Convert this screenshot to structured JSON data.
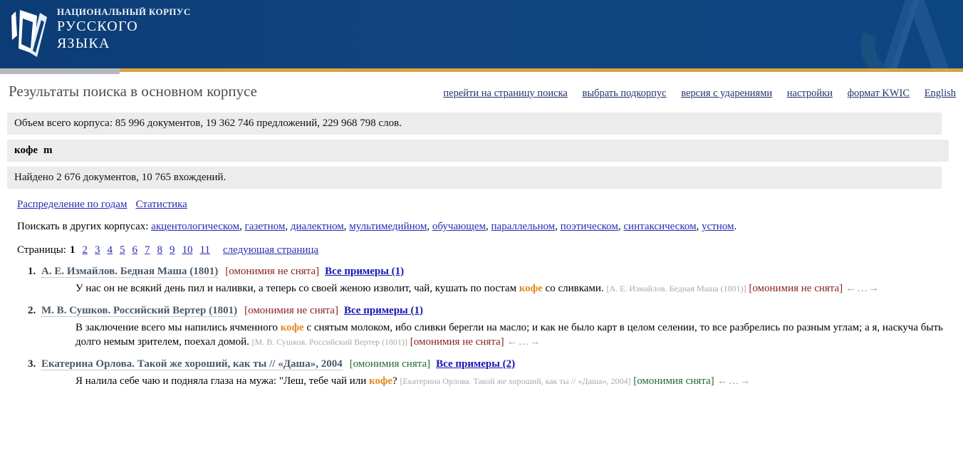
{
  "header": {
    "logo_line1": "Национальный корпус",
    "logo_line2": "Русского",
    "logo_line3": "языка",
    "logo_icon": "open-book-logo",
    "watermark_icon": "letter-a-watermark",
    "brand_blue": "#0c3f7a",
    "accent_gold": "#d9a441"
  },
  "page": {
    "title": "Результаты поиска в основном корпусе"
  },
  "toplinks": [
    {
      "label": "перейти на страницу поиска",
      "name": "link-go-to-search-page"
    },
    {
      "label": "выбрать подкорпус",
      "name": "link-choose-subcorpus"
    },
    {
      "label": "версия с ударениями",
      "name": "link-accented-version"
    },
    {
      "label": "настройки",
      "name": "link-settings"
    },
    {
      "label": "формат KWIC",
      "name": "link-kwic-format"
    },
    {
      "label": "English",
      "name": "link-english"
    }
  ],
  "corpus_info": "Объем всего корпуса: 85 996 документов, 19 362 746 предложений, 229 968 798 слов.",
  "query": {
    "word": "кофе",
    "gram": "m"
  },
  "found_info": "Найдено 2 676 документов, 10 765 вхождений.",
  "stat_links": [
    {
      "label": "Распределение по годам",
      "name": "link-distribution-by-years"
    },
    {
      "label": "Статистика",
      "name": "link-statistics"
    }
  ],
  "other_corpora": {
    "prefix": "Поискать в других корпусах:",
    "items": [
      "акцентологическом",
      "газетном",
      "диалектном",
      "мультимедийном",
      "обучающем",
      "параллельном",
      "поэтическом",
      "синтаксическом",
      "устном"
    ]
  },
  "pagination": {
    "label": "Страницы:",
    "current": "1",
    "pages": [
      "2",
      "3",
      "4",
      "5",
      "6",
      "7",
      "8",
      "9",
      "10",
      "11"
    ],
    "next_label": "следующая страница"
  },
  "results": [
    {
      "title": "А. Е. Измайлов. Бедная Маша (1801)",
      "tag": "[омонимия не снята]",
      "tag_type": "ambiguous",
      "examples_label": "Все примеры (1)",
      "snippet_before": "У нас он не всякий день пил и наливки, а теперь со своей женою изволит, чай, кушать по постам ",
      "keyword": "кофе",
      "snippet_after": " со сливками.",
      "source": "[А. Е. Измайлов. Бедная Маша (1801)]",
      "inline_tag": "[омонимия не снята]",
      "arrows": "←…→"
    },
    {
      "title": "М. В. Сушков. Российский Вертер (1801)",
      "tag": "[омонимия не снята]",
      "tag_type": "ambiguous",
      "examples_label": "Все примеры (1)",
      "snippet_before": "В заключение всего мы напились ячменного ",
      "keyword": "кофе",
      "snippet_after": " с снятым молоком, ибо сливки берегли на масло; и как не было карт в целом селении, то все разбрелись по разным углам; а я, наскуча быть долго немым зрителем, поехал домой.",
      "source": "[М. В. Сушков. Российский Вертер (1801)]",
      "inline_tag": "[омонимия не снята]",
      "arrows": "←…→"
    },
    {
      "title": "Екатерина Орлова. Такой же хороший, как ты // «Даша», 2004",
      "tag": "[омонимия снята]",
      "tag_type": "resolved",
      "examples_label": "Все примеры (2)",
      "snippet_before": "Я налила себе чаю и подняла глаза на мужа: \"Леш, тебе чай или ",
      "keyword": "кофе",
      "snippet_after": "?",
      "source": "[Екатерина Орлова. Такой же хороший, как ты // «Даша», 2004]",
      "inline_tag": "[омонимия снята]",
      "arrows": "←…→"
    }
  ]
}
